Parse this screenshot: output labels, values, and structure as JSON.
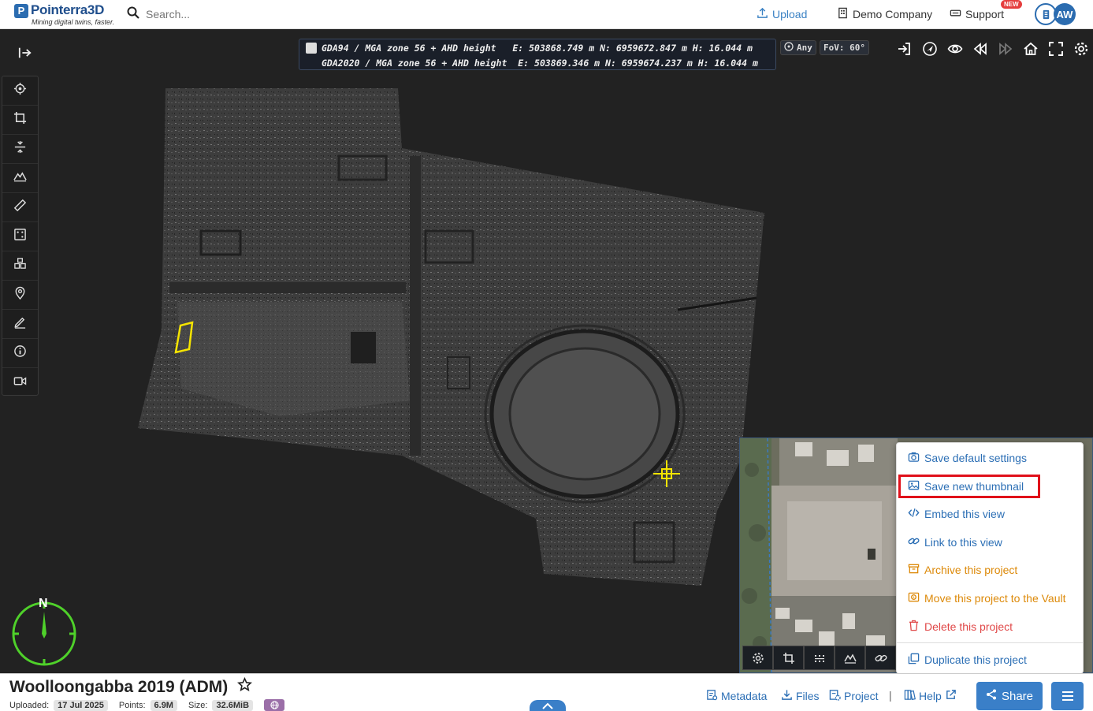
{
  "header": {
    "logo_name": "Pointerra3D",
    "logo_tagline": "Mining digital twins, faster.",
    "search_placeholder": "Search...",
    "upload_label": "Upload",
    "company_label": "Demo Company",
    "support_label": "Support",
    "new_badge": "NEW",
    "avatar_initials": "AW"
  },
  "viewer": {
    "coords": {
      "row1": "GDA94 / MGA zone 56 + AHD height   E: 503868.749 m N: 6959672.847 m H: 16.044 m",
      "row2": "GDA2020 / MGA zone 56 + AHD height  E: 503869.346 m N: 6959674.237 m H: 16.044 m"
    },
    "snap_label": "Any",
    "fov_label": "FoV: 60°",
    "compass_label": "N",
    "toolbar_icons": [
      "locate-icon",
      "crop-icon",
      "section-icon",
      "terrain-icon",
      "measure-icon",
      "area-select-icon",
      "volumes-icon",
      "pin-icon",
      "annotate-icon",
      "info-icon",
      "video-icon"
    ],
    "nav_icons": [
      "enter-icon",
      "navigate-icon",
      "eye-icon",
      "rewind-icon",
      "fast-forward-icon",
      "home-icon",
      "fullscreen-icon",
      "settings-icon"
    ],
    "minimap_tools": [
      "settings-icon",
      "crop-icon",
      "grid-icon",
      "terrain-icon",
      "link-icon"
    ]
  },
  "menu": {
    "items": [
      {
        "label": "Save default settings",
        "icon": "camera-icon",
        "tone": "blue"
      },
      {
        "label": "Save new thumbnail",
        "icon": "image-icon",
        "tone": "blue"
      },
      {
        "label": "Embed this view",
        "icon": "code-icon",
        "tone": "blue"
      },
      {
        "label": "Link to this view",
        "icon": "link-icon",
        "tone": "blue"
      },
      {
        "label": "Archive this project",
        "icon": "archive-icon",
        "tone": "orange"
      },
      {
        "label": "Move this project to the Vault",
        "icon": "vault-icon",
        "tone": "orange"
      },
      {
        "label": "Delete this project",
        "icon": "trash-icon",
        "tone": "red"
      },
      {
        "label": "Duplicate this project",
        "icon": "duplicate-icon",
        "tone": "blue"
      }
    ]
  },
  "project": {
    "title": "Woolloongabba 2019 (ADM)",
    "uploaded_label": "Uploaded:",
    "uploaded_value": "17 Jul 2025",
    "points_label": "Points:",
    "points_value": "6.9M",
    "size_label": "Size:",
    "size_value": "32.6MiB"
  },
  "footer": {
    "metadata_label": "Metadata",
    "files_label": "Files",
    "project_label": "Project",
    "separator": "|",
    "help_label": "Help",
    "share_label": "Share"
  },
  "colors": {
    "accent": "#3a7fc8",
    "link": "#2c6fb5",
    "warning": "#dd8a0a",
    "danger": "#e04848",
    "highlight_box": "#e0101a",
    "compass": "#4fd12a",
    "marker": "#f5e400"
  }
}
